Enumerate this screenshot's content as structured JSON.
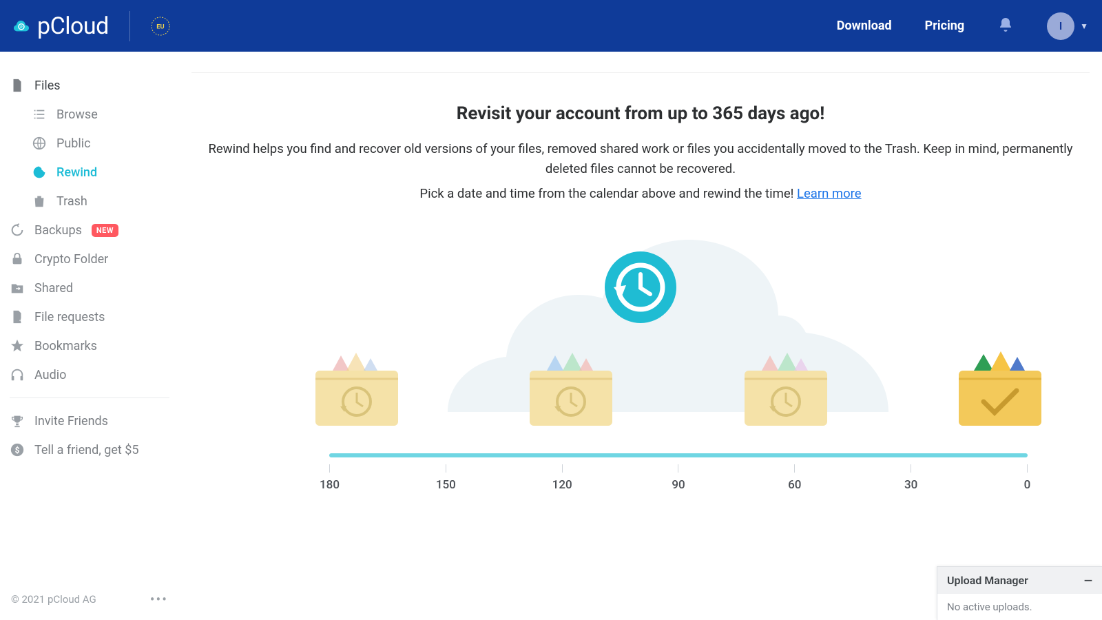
{
  "brand": "pCloud",
  "eu_label": "EU",
  "nav": {
    "download": "Download",
    "pricing": "Pricing"
  },
  "avatar_initial": "I",
  "sidebar": {
    "files": {
      "label": "Files",
      "browse": "Browse",
      "public": "Public",
      "rewind": "Rewind",
      "trash": "Trash"
    },
    "backups": {
      "label": "Backups",
      "badge": "NEW"
    },
    "crypto": "Crypto Folder",
    "shared": "Shared",
    "file_requests": "File requests",
    "bookmarks": "Bookmarks",
    "audio": "Audio",
    "invite": "Invite Friends",
    "tell": "Tell a friend, get $5"
  },
  "footer": {
    "copyright": "© 2021 pCloud AG"
  },
  "main": {
    "headline": "Revisit your account from up to 365 days ago!",
    "desc1": "Rewind helps you find and recover old versions of your files, removed shared work or files you accidentally moved to the Trash. Keep in mind, permanently deleted files cannot be recovered.",
    "desc2_prefix": "Pick a date and time from the calendar above and rewind the time! ",
    "learn_more": "Learn more"
  },
  "timeline": {
    "ticks": [
      "180",
      "150",
      "120",
      "90",
      "60",
      "30",
      "0"
    ]
  },
  "upload_manager": {
    "title": "Upload Manager",
    "body": "No active uploads."
  }
}
